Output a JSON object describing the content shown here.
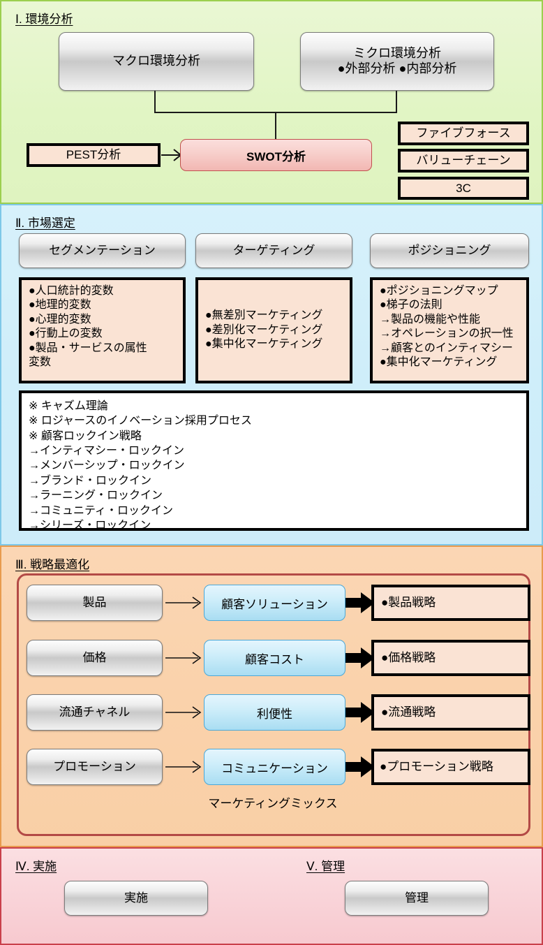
{
  "sections": {
    "s1": {
      "label": "Ⅰ. 環境分析"
    },
    "s2": {
      "label": "Ⅱ. 市場選定"
    },
    "s3": {
      "label": "Ⅲ. 戦略最適化"
    },
    "s4": {
      "label": "Ⅳ. 実施"
    },
    "s5": {
      "label": "Ⅴ. 管理"
    }
  },
  "environment": {
    "macro": "マクロ環境分析",
    "micro": "ミクロ環境分析\n●外部分析 ●内部分析",
    "pest": "PEST分析",
    "swot": "SWOT分析",
    "tools": [
      {
        "label": "ファイブフォース"
      },
      {
        "label": "バリューチェーン"
      },
      {
        "label": "3C"
      }
    ]
  },
  "market": {
    "headers": [
      {
        "label": "セグメンテーション"
      },
      {
        "label": "ターゲティング"
      },
      {
        "label": "ポジショニング"
      }
    ],
    "columns": [
      {
        "text": "●人口統計的変数\n●地理的変数\n●心理的変数\n●行動上の変数\n●製品・サービスの属性\n変数"
      },
      {
        "text": "●無差別マーケティング\n●差別化マーケティング\n●集中化マーケティング"
      },
      {
        "text": "●ポジショニングマップ\n●梯子の法則\n→製品の機能や性能\n→オペレーションの択一性\n→顧客とのインティマシー\n●集中化マーケティング"
      }
    ],
    "notes": "※ キャズム理論\n※ ロジャースのイノベーション採用プロセス\n※ 顧客ロックイン戦略\n→インティマシー・ロックイン\n→メンバーシップ・ロックイン\n→ブランド・ロックイン\n→ラーニング・ロックイン\n→コミュニティ・ロックイン\n→シリーズ・ロックイン"
  },
  "strategy": {
    "mix_label": "マーケティングミックス",
    "rows": [
      {
        "p": "製品",
        "c": "顧客ソリューション",
        "out": "●製品戦略"
      },
      {
        "p": "価格",
        "c": "顧客コスト",
        "out": "●価格戦略"
      },
      {
        "p": "流通チャネル",
        "c": "利便性",
        "out": "●流通戦略"
      },
      {
        "p": "プロモーション",
        "c": "コミュニケーション",
        "out": "●プロモーション戦略"
      }
    ]
  },
  "execution": {
    "do": "実施",
    "manage": "管理"
  },
  "colors": {
    "sec1_bg": "#e1f5c4",
    "sec1_border": "#9ccf4f",
    "sec2_bg": "#cfeefa",
    "sec2_border": "#7ec8e8",
    "sec3_bg": "#fad2ab",
    "sec3_border": "#e89b4e",
    "sec4_bg": "#f9d3d8",
    "sec4_border": "#c9404b",
    "peach": "#fae3d4",
    "swot": "#f2b7b2",
    "blue": "#a9ddf2",
    "redframe": "#b34a46",
    "black": "#000000"
  }
}
